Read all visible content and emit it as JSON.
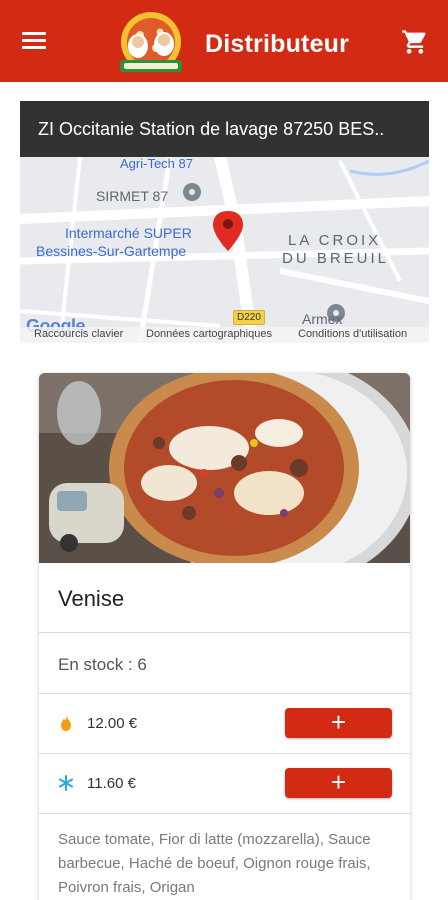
{
  "header": {
    "title": "Distributeur",
    "menu_icon": "hamburger-menu-icon",
    "cart_icon": "shopping-cart-icon",
    "logo": "pizza-chefs-logo",
    "color": "#d32a14"
  },
  "map": {
    "address": "ZI Occitanie Station de lavage 87250 BES..",
    "labels": {
      "tech": "Agri-Tech 87",
      "sirmet": "SIRMET 87",
      "intermarche": "Intermarché SUPER",
      "bessines": "Bessines-Sur-Gartempe",
      "lacroix": "LA CROIX",
      "dubreuil": "DU BREUIL",
      "armex": "Armex",
      "road": "D220",
      "google": "Google"
    },
    "footer": {
      "shortcuts": "Raccourcis clavier",
      "map_data": "Données cartographiques",
      "terms": "Conditions d'utilisation"
    }
  },
  "product": {
    "name": "Venise",
    "stock_label": "En stock : 6",
    "prices": [
      {
        "icon": "flame-icon",
        "label": "12.00  €",
        "color": "#f39c12"
      },
      {
        "icon": "snowflake-icon",
        "label": "11.60  €",
        "color": "#29a8e0"
      }
    ],
    "add_label": "+",
    "description": "Sauce tomate, Fior di latte (mozzarella), Sauce barbecue, Haché de boeuf, Oignon rouge frais, Poivron frais, Origan"
  }
}
